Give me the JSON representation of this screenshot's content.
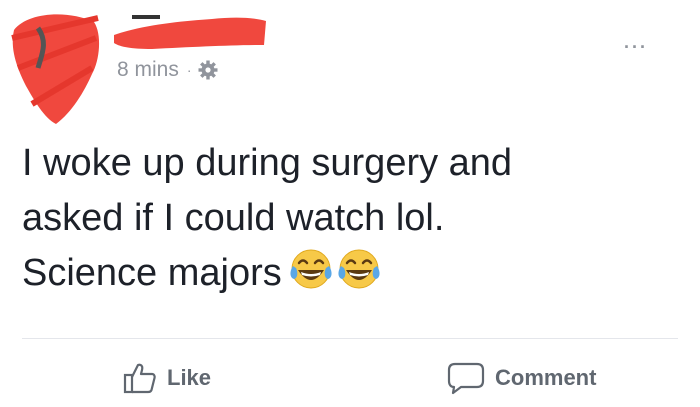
{
  "post": {
    "timestamp": "8 mins",
    "separator": "·",
    "privacy_icon": "gear-icon",
    "more_label": "...",
    "body_lines": [
      "I woke up during surgery and",
      "asked if I could watch lol.",
      "Science majors"
    ],
    "emojis": [
      "face-with-tears-of-joy-emoji",
      "face-with-tears-of-joy-emoji"
    ]
  },
  "actions": {
    "like_label": "Like",
    "comment_label": "Comment"
  },
  "colors": {
    "redaction": "#f0483e",
    "meta_text": "#90949c",
    "action_text": "#606770",
    "body_text": "#1d2129",
    "emoji_yellow": "#f7c948",
    "emoji_tear": "#5aa7e6"
  }
}
